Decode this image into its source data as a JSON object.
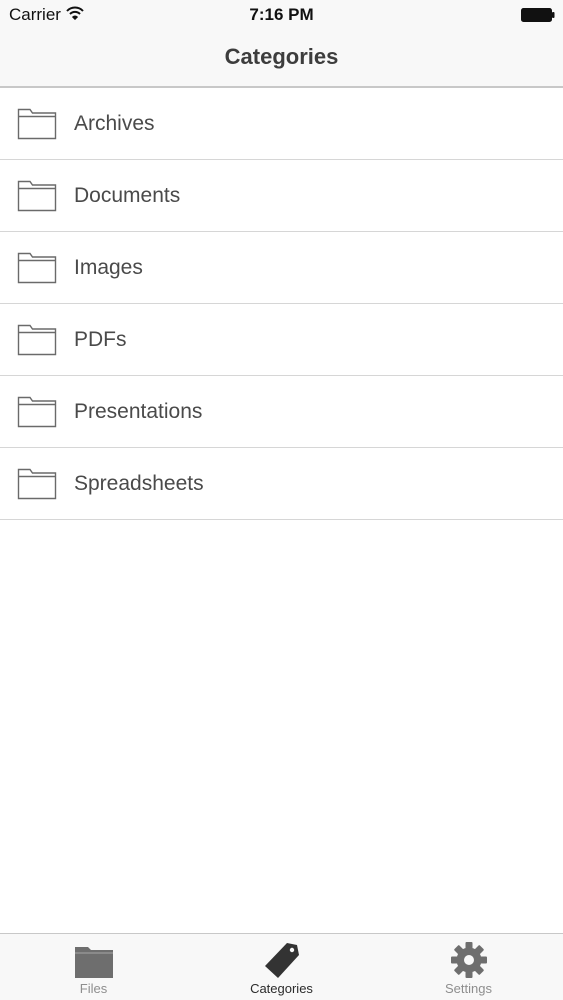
{
  "status_bar": {
    "carrier": "Carrier",
    "time": "7:16 PM",
    "wifi_icon": "wifi-icon",
    "battery_icon": "battery-icon"
  },
  "nav": {
    "title": "Categories"
  },
  "categories": {
    "icon": "folder-icon",
    "items": [
      {
        "label": "Archives"
      },
      {
        "label": "Documents"
      },
      {
        "label": "Images"
      },
      {
        "label": "PDFs"
      },
      {
        "label": "Presentations"
      },
      {
        "label": "Spreadsheets"
      }
    ]
  },
  "tab_bar": {
    "selected": "Categories",
    "tabs": [
      {
        "label": "Files",
        "icon": "folder-filled-icon"
      },
      {
        "label": "Categories",
        "icon": "tag-icon"
      },
      {
        "label": "Settings",
        "icon": "gear-icon"
      }
    ]
  },
  "colors": {
    "bar_background": "#f8f8f8",
    "text": "#4a4a4a",
    "separator": "#d6d6d6",
    "tab_active": "#2b2b2b",
    "tab_inactive": "#8e8e8e"
  }
}
